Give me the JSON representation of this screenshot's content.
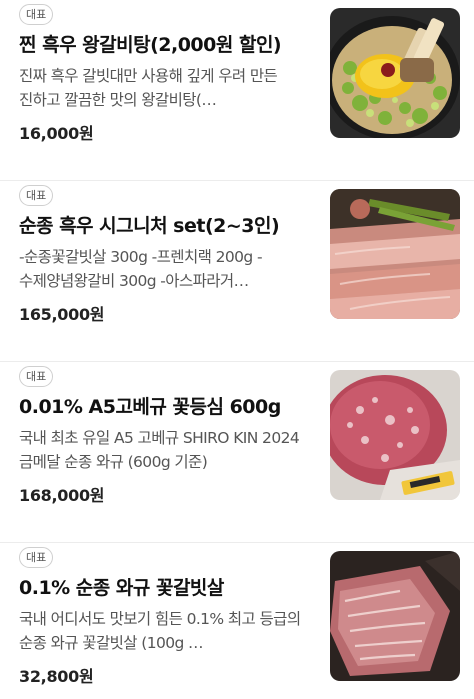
{
  "menu": {
    "items": [
      {
        "badge": "대표",
        "title": "찐 흑우 왕갈비탕(2,000원 할인)",
        "description": "진짜 흑우 갈빗대만 사용해 깊게 우려 만든 진하고 깔끔한 맛의 왕갈비탕(…",
        "price": "16,000원"
      },
      {
        "badge": "대표",
        "title": "순종 흑우 시그니처 set(2~3인)",
        "description": "-순종꽃갈빗살 300g -프렌치랙 200g -수제양념왕갈비 300g -아스파라거…",
        "price": "165,000원"
      },
      {
        "badge": "대표",
        "title": "0.01% A5고베규 꽃등심 600g",
        "description": "국내 최초 유일 A5 고베규 SHIRO KIN 2024 금메달 순종 와규 (600g 기준)",
        "price": "168,000원"
      },
      {
        "badge": "대표",
        "title": "0.1% 순종 와규 꽃갈빗살",
        "description": "국내 어디서도 맛보기 힘든 0.1% 최고 등급의 순종 와규 꽃갈빗살 (100g …",
        "price": "32,800원"
      }
    ]
  }
}
